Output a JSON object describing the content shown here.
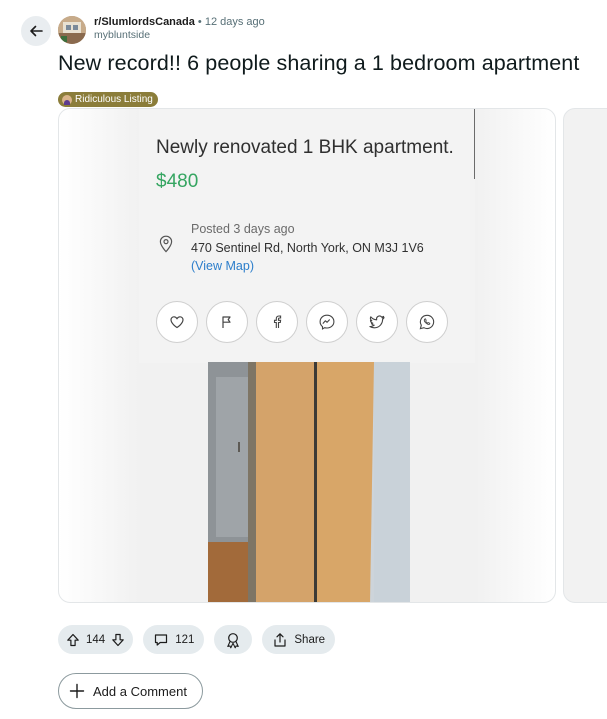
{
  "post": {
    "subreddit": "r/SlumlordsCanada",
    "separator": "•",
    "time": "12 days ago",
    "username": "mybluntside",
    "title": "New record!! 6 people sharing a 1 bedroom apartment",
    "flair": "Ridiculous Listing"
  },
  "listing": {
    "title": "Newly renovated 1 BHK apartment.",
    "price": "$480",
    "posted": "Posted 3 days ago",
    "address": "470 Sentinel Rd, North York, ON M3J 1V6",
    "view_map": "(View Map)",
    "share_icons": [
      "heart-icon",
      "flag-icon",
      "facebook-icon",
      "messenger-icon",
      "twitter-icon",
      "whatsapp-icon"
    ]
  },
  "actions": {
    "upvotes": "144",
    "comments": "121",
    "share_label": "Share"
  },
  "comment": {
    "add_label": "Add a Comment"
  },
  "colors": {
    "price_green": "#35a561",
    "link_blue": "#2c7ecb",
    "flair_bg": "#8b7d3a",
    "pill_bg": "#e5ebee"
  }
}
